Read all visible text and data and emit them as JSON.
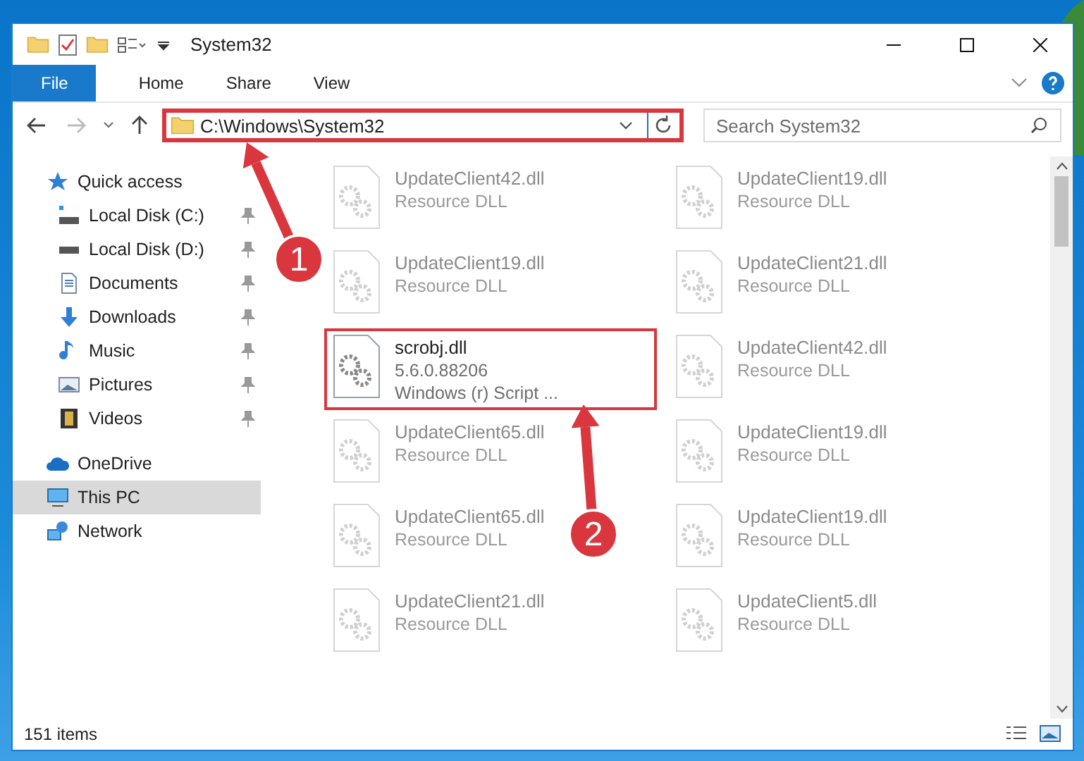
{
  "title_bar": {
    "title": "System32"
  },
  "ribbon_tabs": [
    {
      "label": "File",
      "kind": "file-menu",
      "selected": false
    },
    {
      "label": "Home",
      "kind": "tab",
      "selected": false
    },
    {
      "label": "Share",
      "kind": "tab",
      "selected": false
    },
    {
      "label": "View",
      "kind": "tab",
      "selected": false
    }
  ],
  "address_bar": {
    "path": "C:\\Windows\\System32",
    "highlighted": true
  },
  "search": {
    "placeholder": "Search System32"
  },
  "sidebar": {
    "items": [
      {
        "label": "Quick access",
        "kind": "star",
        "selected": false,
        "children": [
          {
            "label": "Local Disk (C:)",
            "kind": "system-drive",
            "pinned": true,
            "selected": false
          },
          {
            "label": "Local Disk (D:)",
            "kind": "drive",
            "pinned": true,
            "selected": false
          },
          {
            "label": "Documents",
            "kind": "document",
            "pinned": true,
            "selected": false
          },
          {
            "label": "Downloads",
            "kind": "download",
            "pinned": true,
            "selected": false
          },
          {
            "label": "Music",
            "kind": "music",
            "pinned": true,
            "selected": false
          },
          {
            "label": "Pictures",
            "kind": "pictures",
            "pinned": true,
            "selected": false
          },
          {
            "label": "Videos",
            "kind": "videos",
            "pinned": true,
            "selected": false
          }
        ]
      },
      {
        "label": "OneDrive",
        "kind": "cloud",
        "selected": false
      },
      {
        "label": "This PC",
        "kind": "computer",
        "selected": true
      },
      {
        "label": "Network",
        "kind": "network",
        "selected": false
      }
    ]
  },
  "files": [
    {
      "name": "UpdateClient42.dll",
      "details": [
        "Resource DLL"
      ],
      "blurred": true,
      "highlighted": false
    },
    {
      "name": "UpdateClient19.dll",
      "details": [
        "Resource DLL"
      ],
      "blurred": true,
      "highlighted": false
    },
    {
      "name": "UpdateClient19.dll",
      "details": [
        "Resource DLL"
      ],
      "blurred": true,
      "highlighted": false
    },
    {
      "name": "UpdateClient21.dll",
      "details": [
        "Resource DLL"
      ],
      "blurred": true,
      "highlighted": false
    },
    {
      "name": "scrobj.dll",
      "details": [
        "5.6.0.88206",
        "Windows (r) Script ..."
      ],
      "blurred": false,
      "highlighted": true
    },
    {
      "name": "UpdateClient42.dll",
      "details": [
        "Resource DLL"
      ],
      "blurred": true,
      "highlighted": false
    },
    {
      "name": "UpdateClient65.dll",
      "details": [
        "Resource DLL"
      ],
      "blurred": true,
      "highlighted": false
    },
    {
      "name": "UpdateClient19.dll",
      "details": [
        "Resource DLL"
      ],
      "blurred": true,
      "highlighted": false
    },
    {
      "name": "UpdateClient65.dll",
      "details": [
        "Resource DLL"
      ],
      "blurred": true,
      "highlighted": false
    },
    {
      "name": "UpdateClient19.dll",
      "details": [
        "Resource DLL"
      ],
      "blurred": true,
      "highlighted": false
    },
    {
      "name": "UpdateClient21.dll",
      "details": [
        "Resource DLL"
      ],
      "blurred": true,
      "highlighted": false
    },
    {
      "name": "UpdateClient5.dll",
      "details": [
        "Resource DLL"
      ],
      "blurred": true,
      "highlighted": false
    }
  ],
  "status_bar": {
    "item_count": "151 items"
  },
  "annotations": [
    {
      "number": "1"
    },
    {
      "number": "2"
    }
  ]
}
